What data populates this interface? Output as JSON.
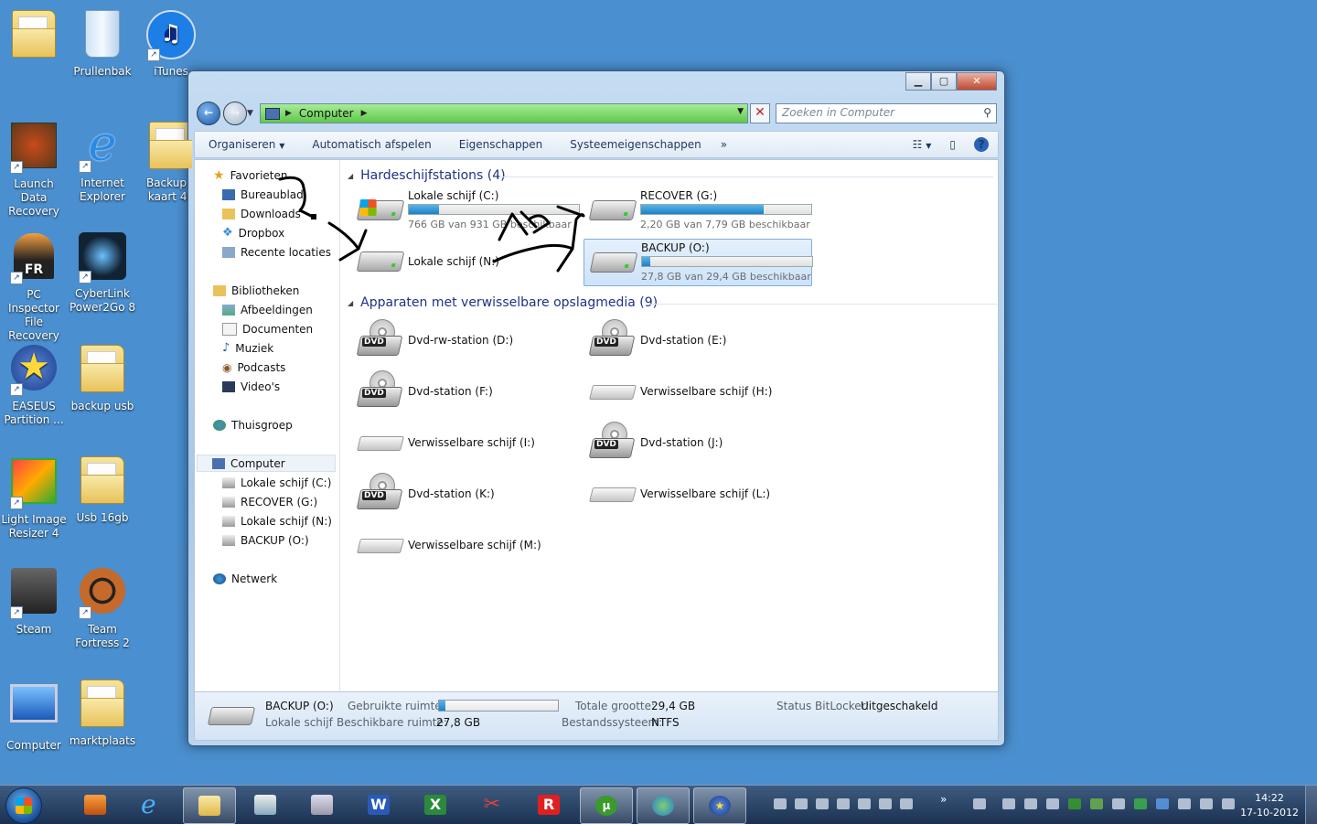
{
  "desktop": {
    "icons": [
      {
        "label": "",
        "kind": "user"
      },
      {
        "label": "Prullenbak",
        "kind": "recycle"
      },
      {
        "label": "iTunes",
        "kind": "itunes"
      },
      {
        "label": "Launch Data Recovery",
        "kind": "app"
      },
      {
        "label": "Internet Explorer",
        "kind": "ie"
      },
      {
        "label": "Backup s kaart 4g",
        "kind": "folder"
      },
      {
        "label": "PC Inspector File Recovery",
        "kind": "app"
      },
      {
        "label": "CyberLink Power2Go 8",
        "kind": "app"
      },
      {
        "label": "EASEUS Partition ...",
        "kind": "app"
      },
      {
        "label": "backup usb",
        "kind": "folder"
      },
      {
        "label": "Light Image Resizer 4",
        "kind": "app"
      },
      {
        "label": "Usb 16gb",
        "kind": "folder"
      },
      {
        "label": "Steam",
        "kind": "steam"
      },
      {
        "label": "Team Fortress 2",
        "kind": "tf2"
      },
      {
        "label": "Computer",
        "kind": "computer"
      },
      {
        "label": "marktplaats",
        "kind": "folder"
      }
    ]
  },
  "window": {
    "address": {
      "crumb": "Computer"
    },
    "search": {
      "placeholder": "Zoeken in Computer"
    },
    "toolbar": {
      "organize": "Organiseren",
      "autoplay": "Automatisch afspelen",
      "properties": "Eigenschappen",
      "system_properties": "Systeemeigenschappen",
      "more": "»"
    },
    "nav": {
      "favorites": "Favorieten",
      "desktop": "Bureaublad",
      "downloads": "Downloads",
      "dropbox": "Dropbox",
      "recent": "Recente locaties",
      "libraries": "Bibliotheken",
      "pictures": "Afbeeldingen",
      "documents": "Documenten",
      "music": "Muziek",
      "podcasts": "Podcasts",
      "videos": "Video's",
      "homegroup": "Thuisgroep",
      "computer": "Computer",
      "drive_c": "Lokale schijf (C:)",
      "drive_g": "RECOVER (G:)",
      "drive_n": "Lokale schijf (N:)",
      "drive_o": "BACKUP (O:)",
      "network": "Netwerk"
    },
    "groups": {
      "hdd_title": "Hardeschijfstations (4)",
      "removable_title": "Apparaten met verwisselbare opslagmedia (9)"
    },
    "hard_drives": [
      {
        "name": "Lokale schijf (C:)",
        "free": "766 GB van 931 GB beschikbaar",
        "used_fraction": 0.18
      },
      {
        "name": "RECOVER (G:)",
        "free": "2,20 GB van 7,79 GB beschikbaar",
        "used_fraction": 0.72
      },
      {
        "name": "Lokale schijf (N:)",
        "free": "",
        "used_fraction": null
      },
      {
        "name": "BACKUP (O:)",
        "free": "27,8 GB van 29,4 GB beschikbaar",
        "used_fraction": 0.05
      }
    ],
    "removable": [
      {
        "name": "Dvd-rw-station (D:)",
        "type": "dvd"
      },
      {
        "name": "Dvd-station (E:)",
        "type": "dvd"
      },
      {
        "name": "Dvd-station (F:)",
        "type": "dvd"
      },
      {
        "name": "Verwisselbare schijf (H:)",
        "type": "removable"
      },
      {
        "name": "Verwisselbare schijf (I:)",
        "type": "removable"
      },
      {
        "name": "Dvd-station (J:)",
        "type": "dvd"
      },
      {
        "name": "Dvd-station (K:)",
        "type": "dvd"
      },
      {
        "name": "Verwisselbare schijf (L:)",
        "type": "removable"
      },
      {
        "name": "Verwisselbare schijf (M:)",
        "type": "removable"
      }
    ],
    "dvd_tag": "DVD",
    "details": {
      "name": "BACKUP (O:)",
      "type": "Lokale schijf",
      "used_label": "Gebruikte ruimte:",
      "used_fraction": 0.05,
      "free_label": "Beschikbare ruimte:",
      "free_value": "27,8 GB",
      "total_label": "Totale grootte:",
      "total_value": "29,4 GB",
      "fs_label": "Bestandssysteem:",
      "fs_value": "NTFS",
      "bitlocker_label": "Status BitLocker:",
      "bitlocker_value": "Uitgeschakeld"
    }
  },
  "taskbar": {
    "time": "14:22",
    "date": "17-10-2012",
    "overflow": "»"
  }
}
